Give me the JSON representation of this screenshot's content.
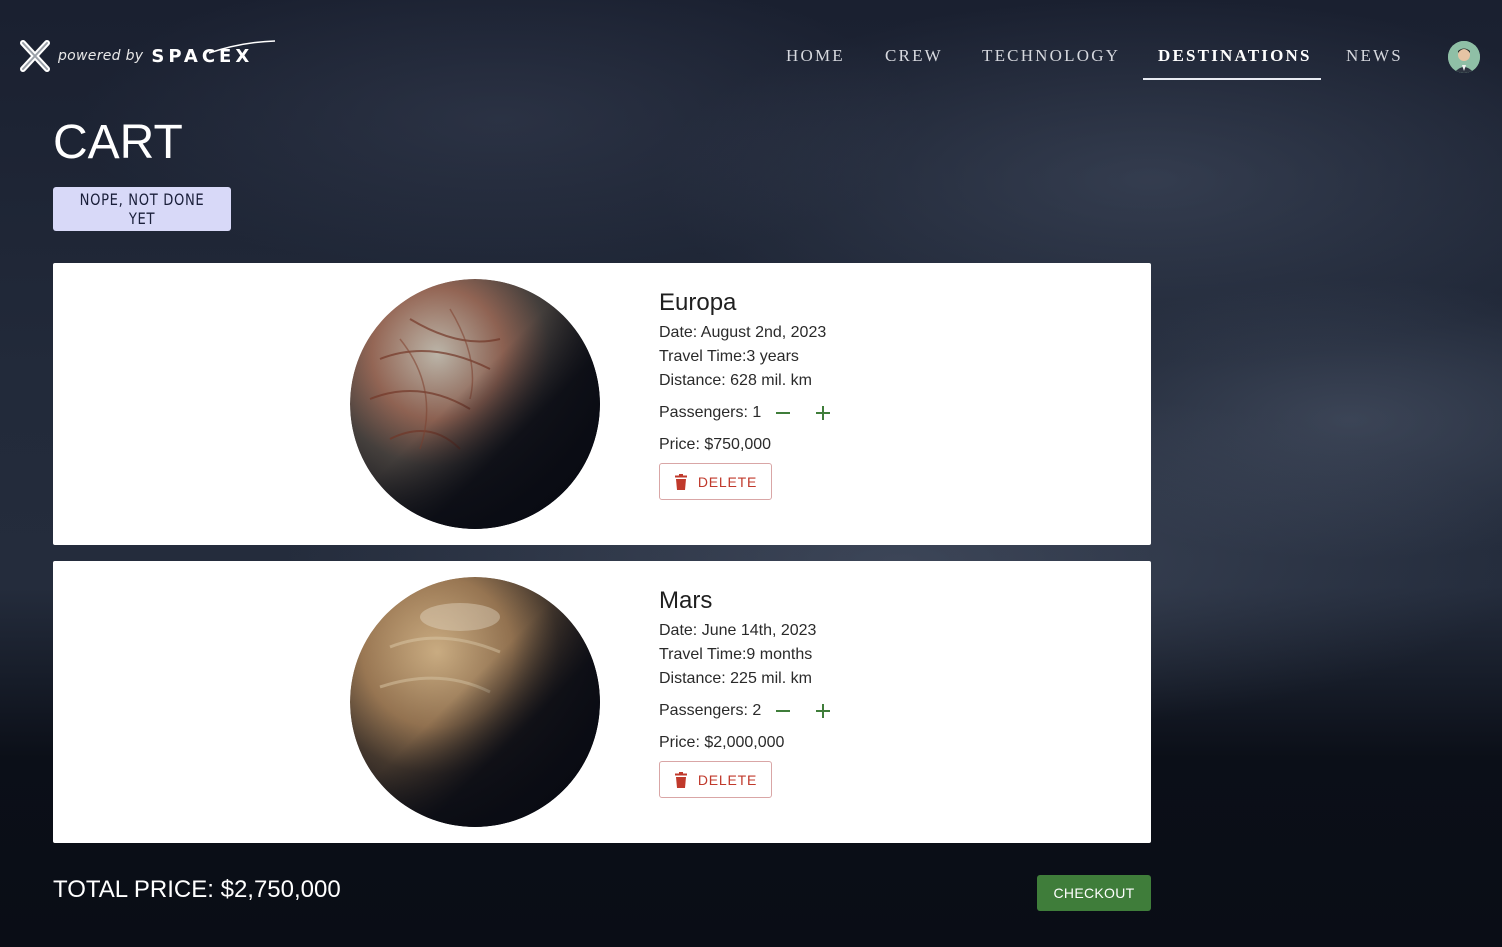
{
  "header": {
    "powered_by": "powered by",
    "brand": "SPACEX",
    "nav": [
      {
        "label": "HOME"
      },
      {
        "label": "CREW"
      },
      {
        "label": "TECHNOLOGY"
      },
      {
        "label": "DESTINATIONS",
        "active": true
      },
      {
        "label": "NEWS"
      }
    ]
  },
  "page": {
    "title": "CART",
    "not_done_label": "NOPE, NOT DONE YET"
  },
  "cart": {
    "items": [
      {
        "name": "Europa",
        "date": "Date: August 2nd, 2023",
        "travel_time": "Travel Time:3 years",
        "distance": "Distance: 628 mil. km",
        "passengers": "Passengers: 1",
        "price": "Price: $750,000",
        "delete_label": "DELETE",
        "planet_color": "#9a7a6a"
      },
      {
        "name": "Mars",
        "date": "Date: June 14th, 2023",
        "travel_time": "Travel Time:9 months",
        "distance": "Distance: 225 mil. km",
        "passengers": "Passengers: 2",
        "price": "Price: $2,000,000",
        "delete_label": "DELETE",
        "planet_color": "#b08a60"
      }
    ],
    "total": "TOTAL PRICE: $2,750,000",
    "checkout_label": "CHECKOUT"
  },
  "colors": {
    "accent_green": "#3f7d3a",
    "delete_red": "#c0392b",
    "nope_button_bg": "#d8d9f8"
  }
}
